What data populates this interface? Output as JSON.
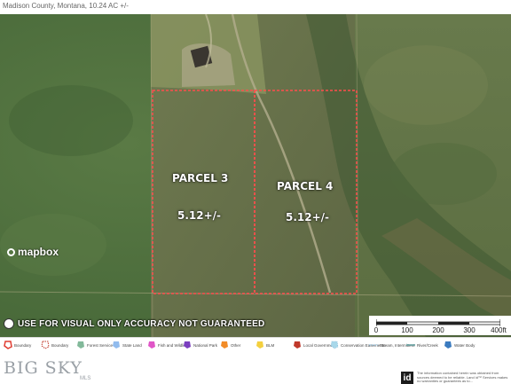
{
  "header": {
    "subtitle": "Madison County, Montana, 10.24 AC +/-"
  },
  "map": {
    "parcels": [
      {
        "name": "PARCEL 3",
        "area": "5.12+/-"
      },
      {
        "name": "PARCEL 4",
        "area": "5.12+/-"
      }
    ],
    "boundary_color": "#ff4d4d",
    "provider": "mapbox",
    "disclaimer": "USE FOR VISUAL ONLY ACCURACY NOT GUARANTEED"
  },
  "scalebar": {
    "labels": [
      "0",
      "100",
      "200",
      "300",
      "400ft"
    ]
  },
  "legend": [
    {
      "label": "Boundary",
      "color": "#e03c31"
    },
    {
      "label": "Boundary",
      "color": "#c0392b"
    },
    {
      "label": "Forest Service",
      "color": "#2e8b57"
    },
    {
      "label": "State Land",
      "color": "#4a90e2"
    },
    {
      "label": "Fish and Wildlife",
      "color": "#e056c7"
    },
    {
      "label": "National Park",
      "color": "#7b3fbf"
    },
    {
      "label": "Other",
      "color": "#f28c28"
    },
    {
      "label": "BLM",
      "color": "#f4d03f"
    },
    {
      "label": "Local Government",
      "color": "#c0392b"
    },
    {
      "label": "Conservation Easements",
      "color": "#a8d8ea"
    },
    {
      "label": "Stream, Intermittent",
      "color": "#7fb3d5"
    },
    {
      "label": "River/Creek",
      "color": "#5d9c9c"
    },
    {
      "label": "Water Body",
      "color": "#3b7bbf"
    }
  ],
  "footer": {
    "brand": "BIG SKY",
    "mls": "MLS",
    "idx": "id",
    "fineprint": "The information contained herein was obtained from sources deemed to be reliable. Land id™ Services makes no warranties or guarantees as to..."
  }
}
